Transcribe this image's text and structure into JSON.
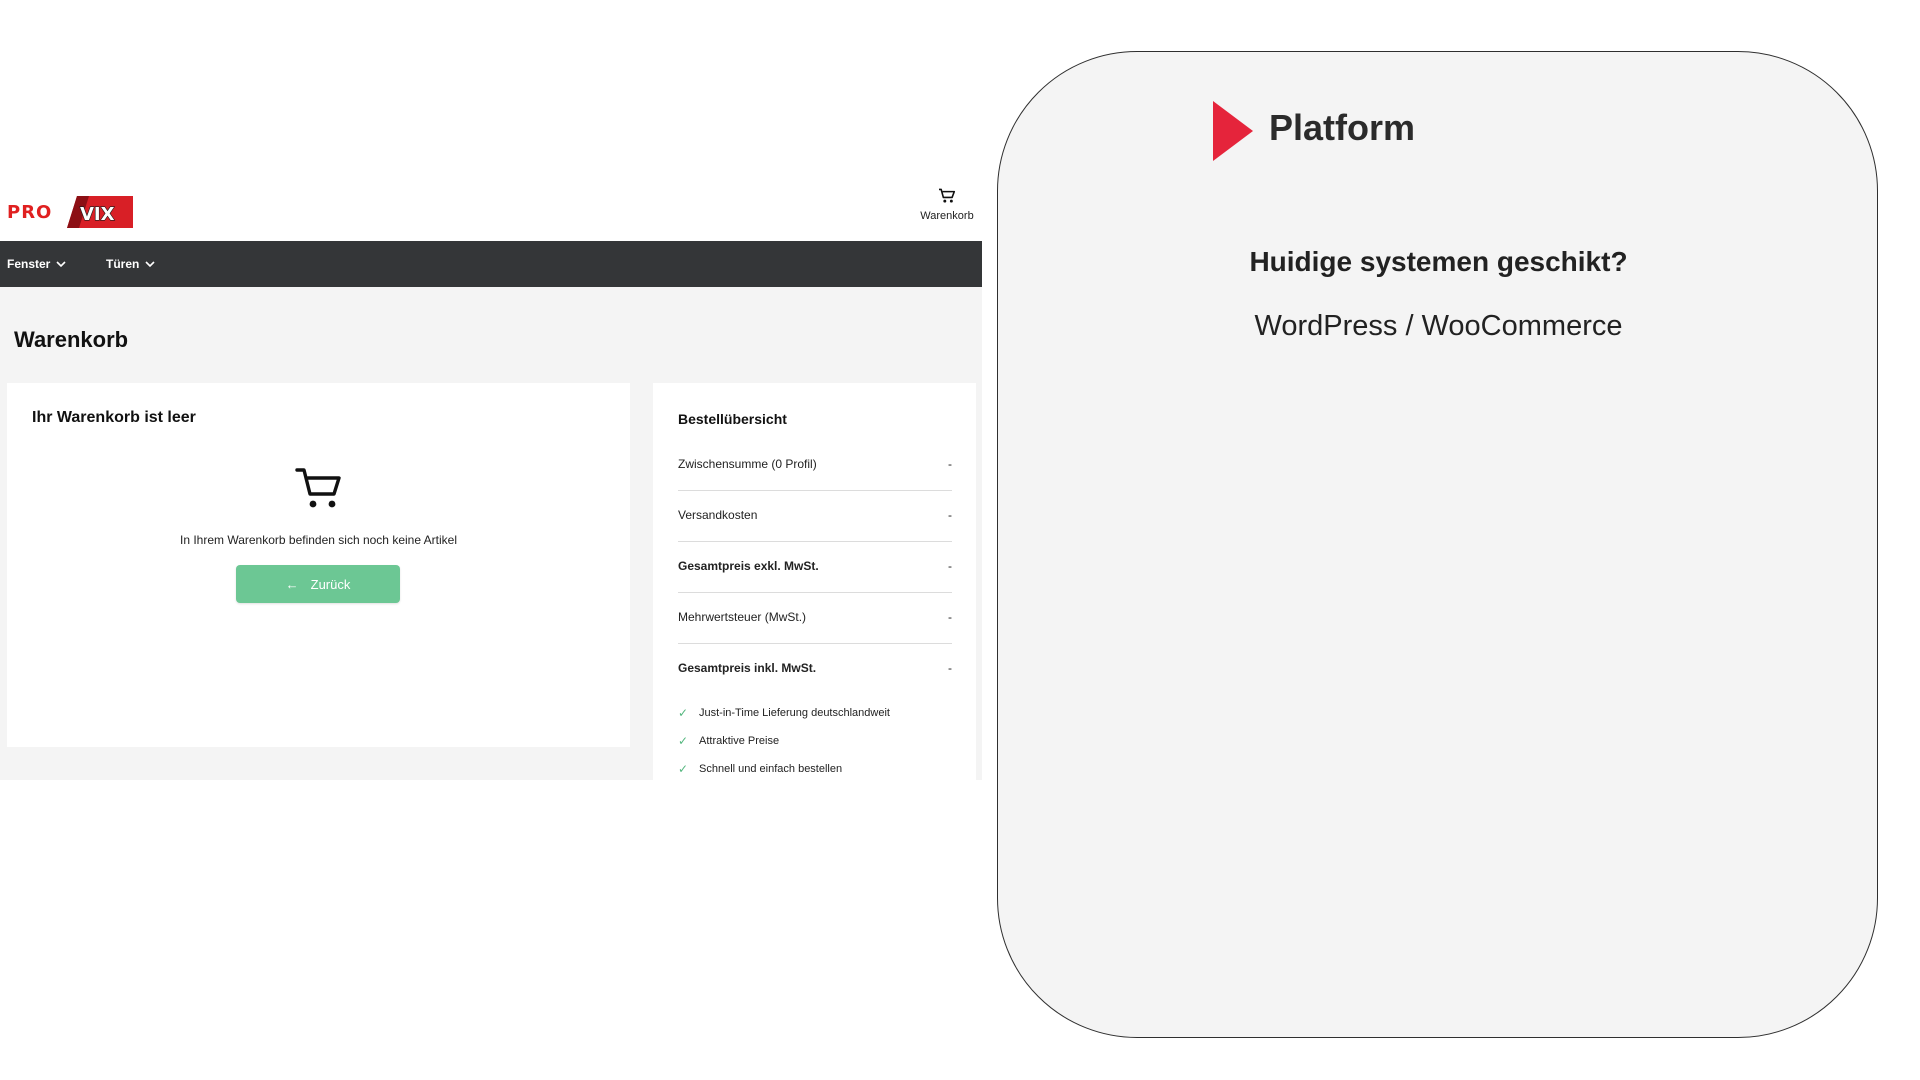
{
  "shop": {
    "logo": {
      "text": "PROVIX",
      "brand_red": "#e02020",
      "brand_dark": "#1a1a1a"
    },
    "header": {
      "cart_icon": "cart-icon",
      "cart_label": "Warenkorb"
    },
    "nav": {
      "items": [
        {
          "label": "Fenster",
          "icon": "chevron-down-icon"
        },
        {
          "label": "Türen",
          "icon": "chevron-down-icon"
        }
      ],
      "background": "#343638"
    },
    "page_title": "Warenkorb",
    "cart": {
      "empty_title": "Ihr Warenkorb ist leer",
      "empty_icon": "cart-icon",
      "empty_text": "In Ihrem Warenkorb befinden sich noch keine Artikel",
      "back_button": {
        "icon": "arrow-left-icon",
        "label": "Zurück",
        "color": "#6cc794"
      }
    },
    "summary": {
      "title": "Bestellübersicht",
      "rows": [
        {
          "label": "Zwischensumme (0 Profil)",
          "value": "-"
        },
        {
          "label": "Versandkosten",
          "value": "-"
        },
        {
          "label": "Gesamtpreis exkl. MwSt.",
          "value": "-"
        },
        {
          "label": "Mehrwertsteuer (MwSt.)",
          "value": "-"
        },
        {
          "label": "Gesamtpreis inkl. MwSt.",
          "value": "-"
        }
      ],
      "features": [
        {
          "icon": "check-icon",
          "label": "Just-in-Time Lieferung deutschlandweit"
        },
        {
          "icon": "check-icon",
          "label": "Attraktive Preise"
        },
        {
          "icon": "check-icon",
          "label": "Schnell und einfach bestellen"
        }
      ],
      "check_color": "#55b77f"
    }
  },
  "slide": {
    "title": "Platform",
    "marker_icon": "play-triangle-icon",
    "marker_color": "#e5243b",
    "question": "Huidige systemen geschikt?",
    "answer": "WordPress / WooCommerce"
  }
}
